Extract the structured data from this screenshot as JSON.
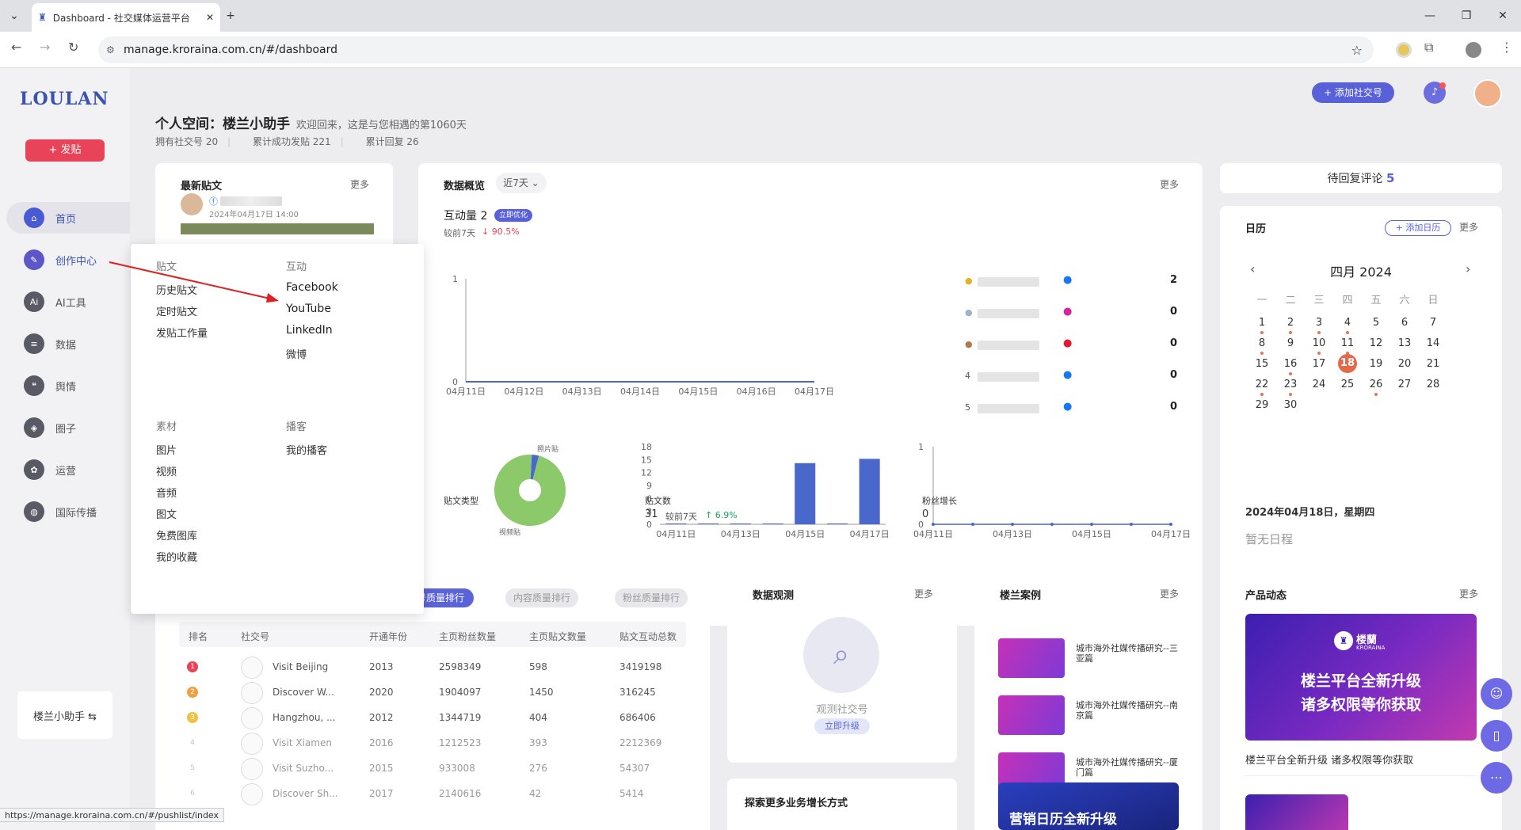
{
  "browser": {
    "tab_title": "Dashboard - 社交媒体运营平台",
    "url": "manage.kroraina.com.cn/#/dashboard",
    "status_url": "https://manage.kroraina.com.cn/#/pushlist/index"
  },
  "sidebar": {
    "logo": "LOULAN",
    "post_button": "+ 发贴",
    "items": [
      {
        "label": "首页",
        "icon": "home-icon"
      },
      {
        "label": "创作中心",
        "icon": "palette-icon"
      },
      {
        "label": "AI工具",
        "icon": "ai-icon"
      },
      {
        "label": "数据",
        "icon": "database-icon"
      },
      {
        "label": "舆情",
        "icon": "quote-icon"
      },
      {
        "label": "圈子",
        "icon": "compass-icon"
      },
      {
        "label": "运营",
        "icon": "gear-icon"
      },
      {
        "label": "国际传播",
        "icon": "globe-icon"
      }
    ],
    "assistant": "楼兰小助手 ⇆"
  },
  "header": {
    "add_social": "+ 添加社交号"
  },
  "welcome": {
    "title": "个人空间：楼兰小助手",
    "subtitle": "欢迎回来，这是与您相遇的第1060天",
    "stats": [
      "拥有社交号 20",
      "累计成功发贴 221",
      "累计回复 26"
    ]
  },
  "latest_posts": {
    "title": "最新贴文",
    "more": "更多",
    "date": "2024年04月17日 14:00"
  },
  "dropdown": {
    "col1_header": "贴文",
    "col1_items": [
      "历史贴文",
      "定时贴文",
      "发贴工作量"
    ],
    "col2_header": "互动",
    "col2_items": [
      "Facebook",
      "YouTube",
      "LinkedIn",
      "微博"
    ],
    "col3_header": "素材",
    "col3_items": [
      "图片",
      "视频",
      "音频",
      "图文",
      "免费图库",
      "我的收藏"
    ],
    "col4_header": "播客",
    "col4_items": [
      "我的播客"
    ]
  },
  "overview": {
    "title": "数据概览",
    "range": "近7天 ⌄",
    "more": "更多",
    "interaction": "互动量 2",
    "interaction_badge": "立即优化",
    "compare": "较前7天",
    "compare_val": "↓ 90.5%",
    "post_type_title": "贴文类型",
    "pie_labels": [
      "照片贴",
      "视频贴"
    ],
    "post_count_title": "贴文数",
    "post_count": "31",
    "post_compare": "较前7天",
    "post_compare_val": "↑ 6.9%",
    "fans_title": "粉丝增长",
    "fans_value": "0"
  },
  "chart_data": [
    {
      "type": "line",
      "x": [
        "04月11日",
        "04月12日",
        "04月13日",
        "04月14日",
        "04月15日",
        "04月16日",
        "04月17日"
      ],
      "values": [
        0,
        0,
        0,
        0,
        0,
        0,
        0
      ],
      "ylim": [
        0,
        1
      ]
    },
    {
      "type": "pie",
      "labels": [
        "照片贴",
        "视频贴"
      ],
      "values": [
        1,
        30
      ]
    },
    {
      "type": "bar",
      "categories": [
        "04月11日",
        "04月12日",
        "04月13日",
        "04月14日",
        "04月15日",
        "04月16日",
        "04月17日"
      ],
      "values": [
        0,
        0,
        0,
        0,
        14,
        0,
        15
      ],
      "yticks": [
        "18",
        "15",
        "12",
        "9",
        "6",
        "3",
        "0"
      ],
      "ylim": [
        0,
        18
      ]
    },
    {
      "type": "line",
      "x": [
        "04月11日",
        "04月12日",
        "04月13日",
        "04月14日",
        "04月15日",
        "04月16日",
        "04月17日"
      ],
      "values": [
        0,
        0,
        0,
        0,
        0,
        0,
        0
      ],
      "ylim": [
        0,
        1
      ]
    }
  ],
  "ranking": [
    {
      "rank": "",
      "platform": "facebook",
      "value": "2"
    },
    {
      "rank": "",
      "platform": "instagram",
      "value": "0"
    },
    {
      "rank": "",
      "platform": "weibo",
      "value": "0"
    },
    {
      "rank": "4",
      "platform": "facebook",
      "value": "0"
    },
    {
      "rank": "5",
      "platform": "facebook",
      "value": "0"
    }
  ],
  "pending": {
    "label": "待回复评论",
    "count": "5"
  },
  "calendar": {
    "title": "日历",
    "add": "+ 添加日历",
    "more": "更多",
    "month": "四月 2024",
    "dow": [
      "一",
      "二",
      "三",
      "四",
      "五",
      "六",
      "日"
    ],
    "today": "18",
    "selected_date": "2024年04月18日，星期四",
    "empty": "暂无日程"
  },
  "table": {
    "tabs": [
      "号质量排行",
      "内容质量排行",
      "粉丝质量排行"
    ],
    "headers": [
      "排名",
      "社交号",
      "开通年份",
      "主页粉丝数量",
      "主页贴文数量",
      "贴文互动总数"
    ],
    "rows": [
      [
        "1",
        "Visit Beijing",
        "2013",
        "2598349",
        "598",
        "3419198"
      ],
      [
        "2",
        "Discover W...",
        "2020",
        "1904097",
        "1450",
        "316245"
      ],
      [
        "3",
        "Hangzhou, ...",
        "2012",
        "1344719",
        "404",
        "686406"
      ],
      [
        "4",
        "Visit Xiamen",
        "2016",
        "1212523",
        "393",
        "2212369"
      ],
      [
        "5",
        "Visit Suzho...",
        "2015",
        "933008",
        "276",
        "54307"
      ],
      [
        "6",
        "Discover Sh...",
        "2017",
        "2140616",
        "42",
        "5414"
      ]
    ]
  },
  "observe": {
    "title": "数据观测",
    "more": "更多",
    "text": "观测社交号",
    "button": "立即升级"
  },
  "explore": {
    "title": "探索更多业务增长方式"
  },
  "cases": {
    "title": "楼兰案例",
    "more": "更多",
    "items": [
      "城市海外社媒传播研究--三亚篇",
      "城市海外社媒传播研究--南京篇",
      "城市海外社媒传播研究--厦门篇"
    ],
    "bottom_banner": "营销日历全新升级"
  },
  "product": {
    "title": "产品动态",
    "more": "更多",
    "banner_brand": "楼蘭",
    "banner_brand_sub": "KRORAINA",
    "banner_line1": "楼兰平台全新升级",
    "banner_line2": "诸多权限等你获取",
    "caption": "楼兰平台全新升级 诸多权限等你获取"
  },
  "colors": {
    "accent": "#5961d9",
    "brand_red": "#e84358",
    "bar": "#4a67cc",
    "pie": "#8cc96a"
  }
}
